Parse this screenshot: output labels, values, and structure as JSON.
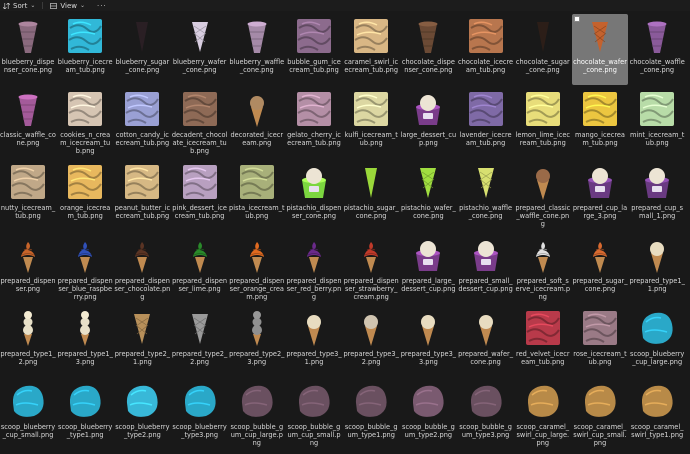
{
  "toolbar": {
    "sort_label": "Sort",
    "view_label": "View",
    "more_label": "···"
  },
  "files": [
    {
      "name": "blueberry_dispenser_cone.png",
      "kind": "cone",
      "color": "#8a6a7e"
    },
    {
      "name": "blueberry_icecream_tub.png",
      "kind": "tub",
      "color": "#31b8d8"
    },
    {
      "name": "blueberry_sugar_cone.png",
      "kind": "sugar",
      "color": "#2a1f24"
    },
    {
      "name": "blueberry_wafer_cone.png",
      "kind": "wafer",
      "color": "#d8cde0"
    },
    {
      "name": "blueberry_waffle_cone.png",
      "kind": "cone",
      "color": "#a58aa8"
    },
    {
      "name": "bubble_gum_icecream_tub.png",
      "kind": "tub",
      "color": "#8c6b8d"
    },
    {
      "name": "caramel_swirl_icecream_tub.png",
      "kind": "tub",
      "color": "#d9b785"
    },
    {
      "name": "chocolate_dispenser_cone.png",
      "kind": "cone",
      "color": "#6b4a35"
    },
    {
      "name": "chocolate_icecream_tub.png",
      "kind": "tub",
      "color": "#b8764e"
    },
    {
      "name": "chocolate_sugar_cone.png",
      "kind": "sugar",
      "color": "#2c1e18"
    },
    {
      "name": "chocolate_wafer_cone.png",
      "kind": "wafer",
      "color": "#c4622e"
    },
    {
      "name": "chocolate_waffle_cone.png",
      "kind": "cone",
      "color": "#8a5a9a"
    },
    {
      "name": "classic_waffle_cone.png",
      "kind": "cone",
      "color": "#a45a9a"
    },
    {
      "name": "cookies_n_cream_icecream_tub.png",
      "kind": "tub",
      "color": "#d6c5b3"
    },
    {
      "name": "cotton_candy_icecream_tub.png",
      "kind": "tub",
      "color": "#9aa0d4"
    },
    {
      "name": "decadent_chocolate_icecream_tub.png",
      "kind": "tub",
      "color": "#8e6a56"
    },
    {
      "name": "decorated_icecream.png",
      "kind": "scoopcone",
      "color": "#b08a62"
    },
    {
      "name": "gelato_cherry_icecream_tub.png",
      "kind": "tub",
      "color": "#b48fa6"
    },
    {
      "name": "kulfi_icecream_tub.png",
      "kind": "tub",
      "color": "#dcd7a2"
    },
    {
      "name": "large_dessert_cup.png",
      "kind": "cup",
      "color": "#7a3c8a"
    },
    {
      "name": "lavender_icecream_tub.png",
      "kind": "tub",
      "color": "#7f6aa6"
    },
    {
      "name": "lemon_lime_icecream_tub.png",
      "kind": "tub",
      "color": "#e8dd7a"
    },
    {
      "name": "mango_icecream_tub.png",
      "kind": "tub",
      "color": "#ecc640"
    },
    {
      "name": "mint_icecream_tub.png",
      "kind": "tub",
      "color": "#b8dca8"
    },
    {
      "name": "nutty_icecream_tub.png",
      "kind": "tub",
      "color": "#c0a888"
    },
    {
      "name": "orange_icecream_tub.png",
      "kind": "tub",
      "color": "#e8b85e"
    },
    {
      "name": "peanut_butter_icecream_tub.png",
      "kind": "tub",
      "color": "#d6b884"
    },
    {
      "name": "pink_dessert_icecream_tub.png",
      "kind": "tub",
      "color": "#b8a0c0"
    },
    {
      "name": "pista_icecream_tub.png",
      "kind": "tub",
      "color": "#a8b07a"
    },
    {
      "name": "pistachio_dispenser_cone.png",
      "kind": "cup",
      "color": "#7cd640"
    },
    {
      "name": "pistachio_sugar_cone.png",
      "kind": "sugar",
      "color": "#9ad83a"
    },
    {
      "name": "pistachio_wafer_cone.png",
      "kind": "wafer",
      "color": "#a0de40"
    },
    {
      "name": "pistachio_waffle_cone.png",
      "kind": "wafer",
      "color": "#d8e070"
    },
    {
      "name": "prepared_classic_waffle_cone.png",
      "kind": "scoopcone",
      "color": "#9a6a48"
    },
    {
      "name": "prepared_cup_large_3.png",
      "kind": "cup",
      "color": "#6a3a82"
    },
    {
      "name": "prepared_cup_small_1.png",
      "kind": "cup",
      "color": "#6a3a82"
    },
    {
      "name": "prepared_dispenser.png",
      "kind": "softserve",
      "color": "#c8642a"
    },
    {
      "name": "prepared_dispenser_blue_raspberry.png",
      "kind": "softserve",
      "color": "#3050b8"
    },
    {
      "name": "prepared_dispenser_chocolate.png",
      "kind": "softserve",
      "color": "#5a3424"
    },
    {
      "name": "prepared_dispenser_lime.png",
      "kind": "softserve",
      "color": "#2a8a2a"
    },
    {
      "name": "prepared_dispenser_orange_cream.png",
      "kind": "softserve",
      "color": "#e06a20"
    },
    {
      "name": "prepared_dispenser_red_berry.png",
      "kind": "softserve",
      "color": "#6a2a8a"
    },
    {
      "name": "prepared_dispenser_strawberry_cream.png",
      "kind": "softserve",
      "color": "#c03a2a"
    },
    {
      "name": "prepared_large_dessert_cup.png",
      "kind": "cup",
      "color": "#7a3c8a"
    },
    {
      "name": "prepared_small_dessert_cup.png",
      "kind": "cup",
      "color": "#7a3c8a"
    },
    {
      "name": "prepared_soft_serve_icecream.png",
      "kind": "softserve",
      "color": "#e0e0e0"
    },
    {
      "name": "prepared_sugar_cone.png",
      "kind": "softserve",
      "color": "#d86a30"
    },
    {
      "name": "prepared_type1_1.png",
      "kind": "scoopcone",
      "color": "#e8dcc0"
    },
    {
      "name": "prepared_type1_2.png",
      "kind": "tower",
      "color": "#e8e0c8"
    },
    {
      "name": "prepared_type1_3.png",
      "kind": "tower",
      "color": "#e8e0c8"
    },
    {
      "name": "prepared_type2_1.png",
      "kind": "wafer",
      "color": "#b8905a"
    },
    {
      "name": "prepared_type2_2.png",
      "kind": "wafer",
      "color": "#9a9a9a"
    },
    {
      "name": "prepared_type2_3.png",
      "kind": "tower",
      "color": "#909090"
    },
    {
      "name": "prepared_type3_1.png",
      "kind": "scoopcone",
      "color": "#e8dcc0"
    },
    {
      "name": "prepared_type3_2.png",
      "kind": "scoopcone",
      "color": "#d0c4b0"
    },
    {
      "name": "prepared_type3_3.png",
      "kind": "scoopcone",
      "color": "#e8dcc0"
    },
    {
      "name": "prepared_wafer_cone.png",
      "kind": "scoopcone",
      "color": "#e8dcc0"
    },
    {
      "name": "red_velvet_icecream_tub.png",
      "kind": "tub",
      "color": "#b83a4a"
    },
    {
      "name": "rose_icecream_tub.png",
      "kind": "tub",
      "color": "#9a7a86"
    },
    {
      "name": "scoop_blueberry_cup_large.png",
      "kind": "scoop",
      "color": "#2aa8c8"
    },
    {
      "name": "scoop_blueberry_cup_small.png",
      "kind": "scoop",
      "color": "#2aa8c8"
    },
    {
      "name": "scoop_blueberry_type1.png",
      "kind": "scoop",
      "color": "#2aa8c8"
    },
    {
      "name": "scoop_blueberry_type2.png",
      "kind": "scoop",
      "color": "#38b8d8"
    },
    {
      "name": "scoop_blueberry_type3.png",
      "kind": "scoop",
      "color": "#2aa8c8"
    },
    {
      "name": "scoop_bubble_gum_cup_large.png",
      "kind": "scoop",
      "color": "#6a5060"
    },
    {
      "name": "scoop_bubble_gum_cup_small.png",
      "kind": "scoop",
      "color": "#6a5060"
    },
    {
      "name": "scoop_bubble_gum_type1.png",
      "kind": "scoop",
      "color": "#6a5060"
    },
    {
      "name": "scoop_bubble_gum_type2.png",
      "kind": "scoop",
      "color": "#7a5a70"
    },
    {
      "name": "scoop_bubble_gum_type3.png",
      "kind": "scoop",
      "color": "#6a5060"
    },
    {
      "name": "scoop_caramel_swirl_cup_large.png",
      "kind": "scoop",
      "color": "#b88a48"
    },
    {
      "name": "scoop_caramel_swirl_cup_small.png",
      "kind": "scoop",
      "color": "#b88a48"
    },
    {
      "name": "scoop_caramel_swirl_type1.png",
      "kind": "scoop",
      "color": "#b88a48"
    }
  ],
  "selected_index": 10,
  "cols": 12
}
